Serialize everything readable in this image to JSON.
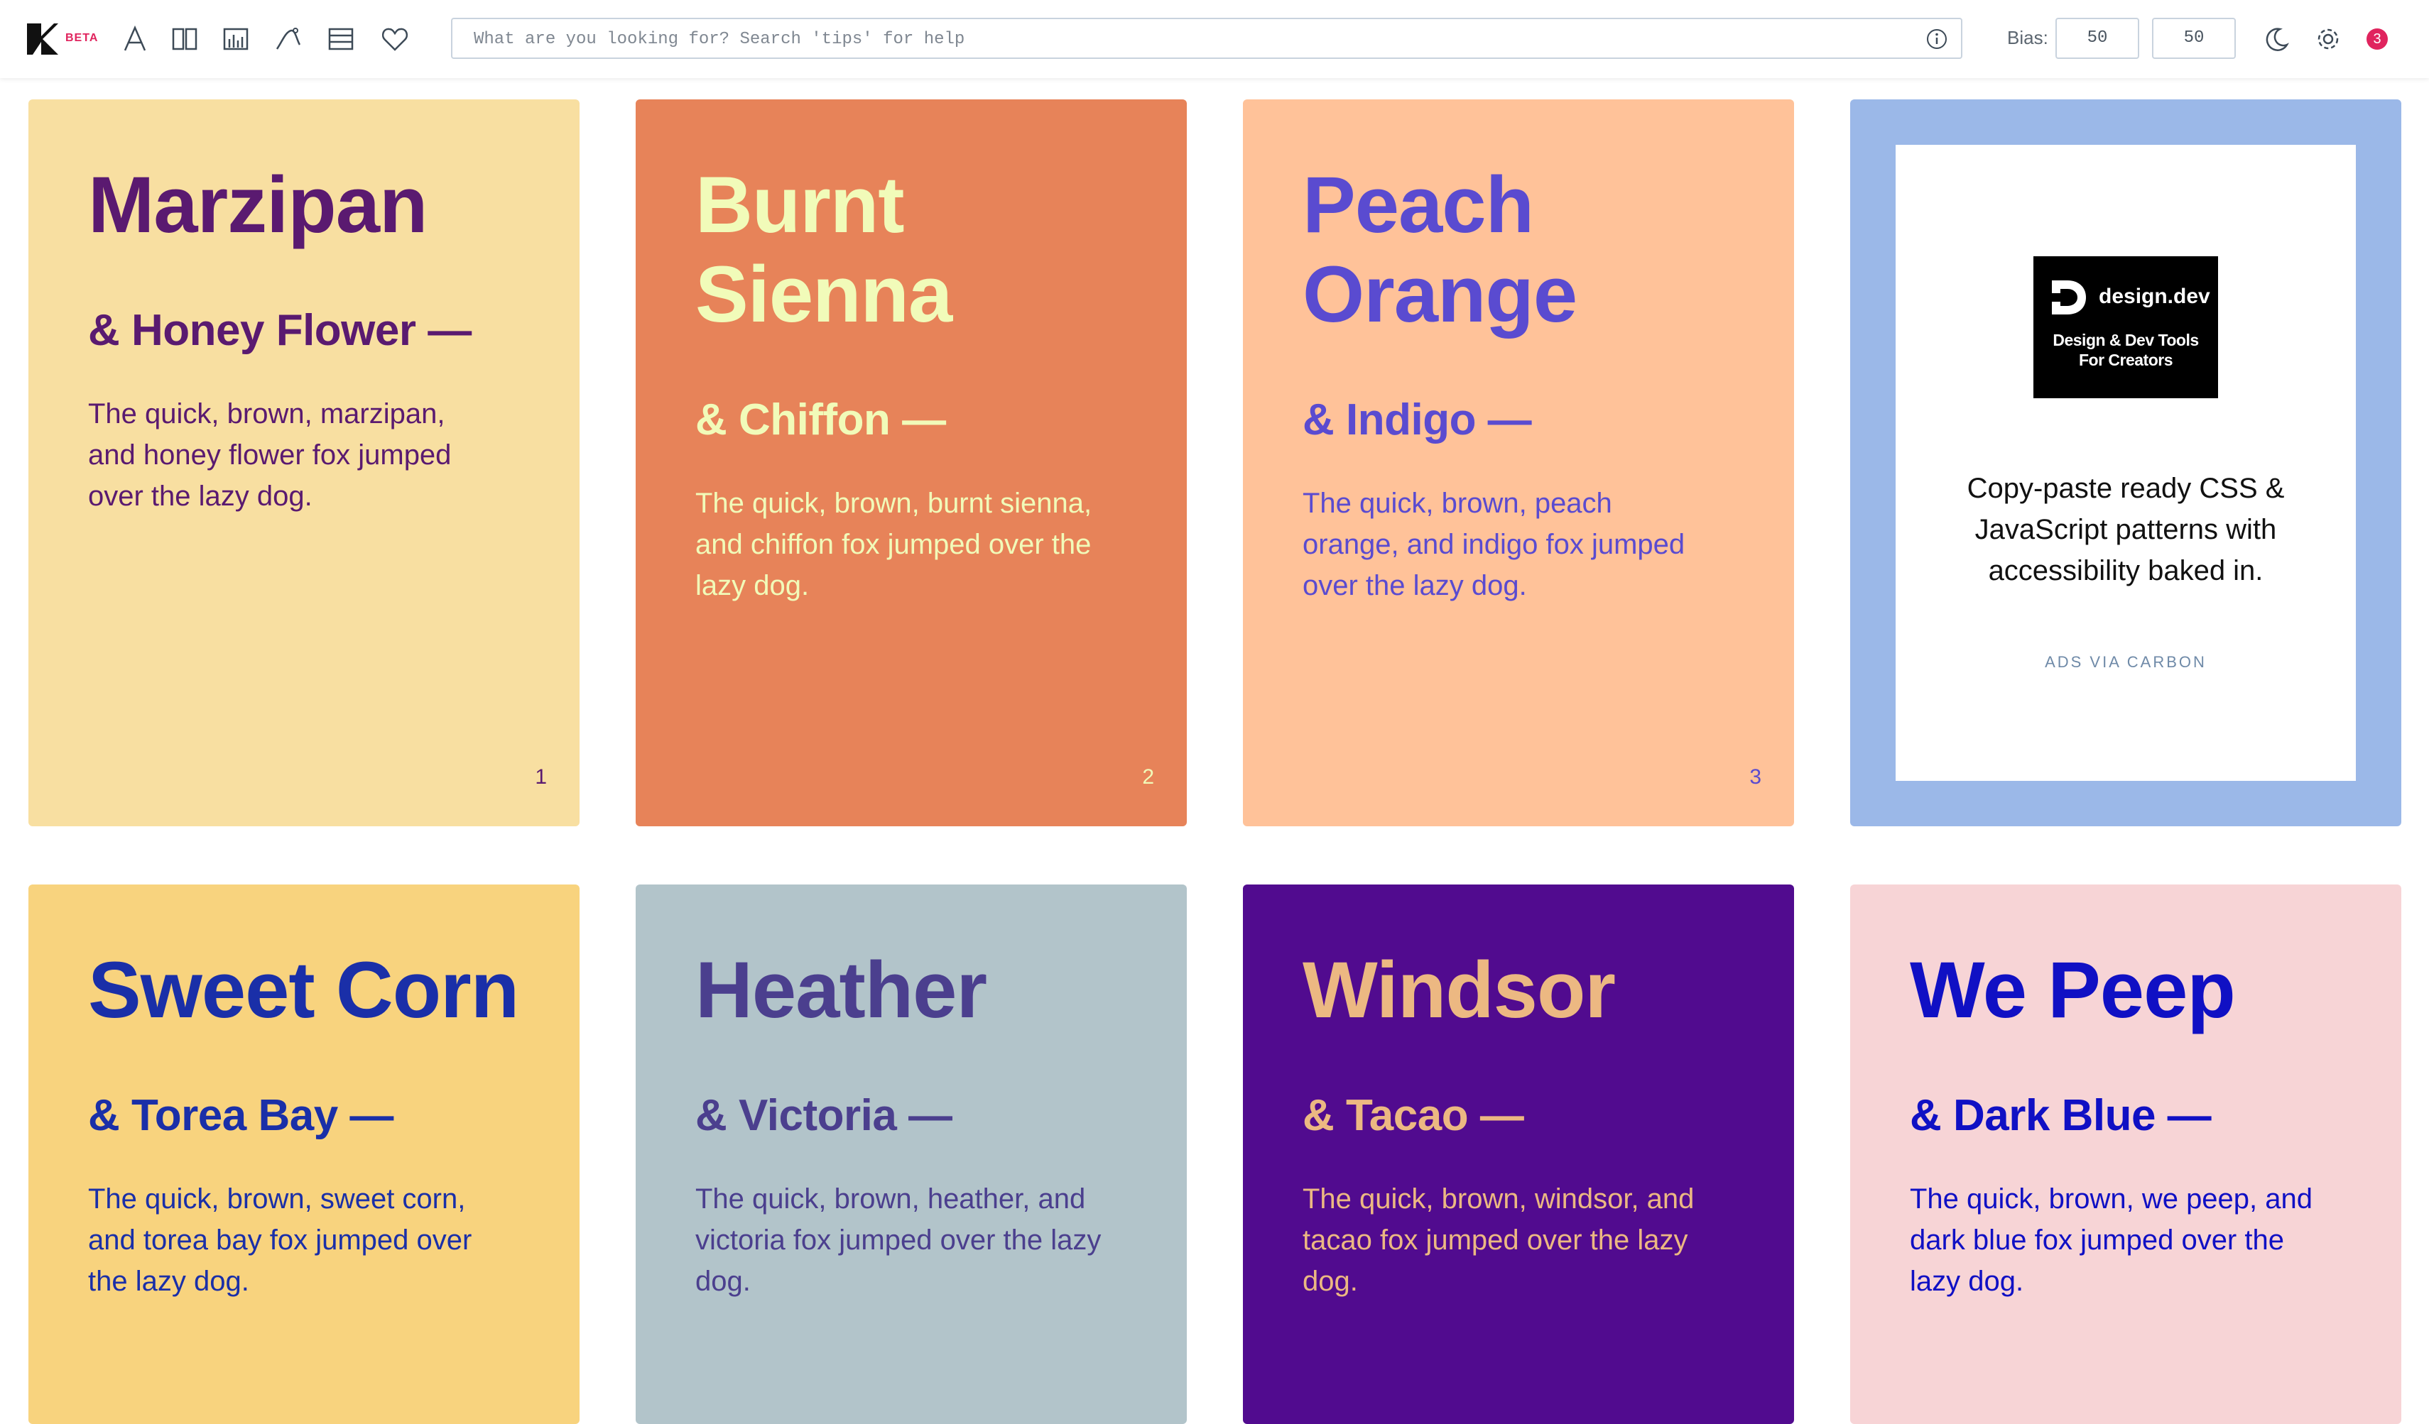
{
  "app": {
    "beta_label": "BETA",
    "icons": [
      "logo-icon",
      "font-icon",
      "columns-icon",
      "chart-icon",
      "curve-icon",
      "rows-icon",
      "heart-icon",
      "info-icon",
      "moon-icon",
      "gear-icon"
    ]
  },
  "search": {
    "placeholder": "What are you looking for? Search 'tips' for help",
    "value": ""
  },
  "bias": {
    "label": "Bias:",
    "value1": "50",
    "value2": "50"
  },
  "notifications": {
    "count": "3"
  },
  "cards": [
    {
      "title_lines": [
        "Marzipan"
      ],
      "subtitle": "& Honey Flower —",
      "body_lines": [
        "The quick, brown, marzipan,",
        "and honey flower fox jumped",
        "over the lazy dog."
      ],
      "number": "1",
      "bg": "#f8dfa1",
      "fg": "#5a1a70"
    },
    {
      "title_lines": [
        "Burnt",
        "Sienna"
      ],
      "subtitle": "& Chiffon —",
      "body_lines": [
        "The quick, brown, burnt sienna,",
        "and chiffon fox jumped over the",
        "lazy dog."
      ],
      "number": "2",
      "bg": "#e78359",
      "fg": "#f1fbb9"
    },
    {
      "title_lines": [
        "Peach",
        "Orange"
      ],
      "subtitle": "& Indigo —",
      "body_lines": [
        "The quick, brown, peach",
        "orange, and indigo fox jumped",
        "over the lazy dog."
      ],
      "number": "3",
      "bg": "#ffc299",
      "fg": "#5a4bd0"
    },
    {
      "title_lines": [
        "Sweet Corn"
      ],
      "subtitle": "& Torea Bay —",
      "body_lines": [
        "The quick, brown, sweet corn,",
        "and torea bay fox jumped over",
        "the lazy dog."
      ],
      "number": "",
      "bg": "#f8d37e",
      "fg": "#1a2fa8"
    },
    {
      "title_lines": [
        "Heather"
      ],
      "subtitle": "& Victoria —",
      "body_lines": [
        "The quick, brown, heather, and",
        "victoria fox jumped over the lazy",
        "dog."
      ],
      "number": "",
      "bg": "#b2c4ca",
      "fg": "#4b3f8e"
    },
    {
      "title_lines": [
        "Windsor"
      ],
      "subtitle": "& Tacao —",
      "body_lines": [
        "The quick, brown, windsor, and",
        "tacao fox jumped over the lazy",
        "dog."
      ],
      "number": "",
      "bg": "#510b8f",
      "fg": "#ecb882"
    },
    {
      "title_lines": [
        "We Peep"
      ],
      "subtitle": "& Dark Blue —",
      "body_lines": [
        "The quick, brown, we peep, and",
        "dark blue fox jumped over the",
        "lazy dog."
      ],
      "number": "",
      "bg": "#f7d4d6",
      "fg": "#1010c4"
    }
  ],
  "ad": {
    "brand": "design.dev",
    "tagline_lines": [
      "Design & Dev Tools",
      "For Creators"
    ],
    "text_lines": [
      "Copy-paste ready CSS &",
      "JavaScript patterns with",
      "accessibility baked in."
    ],
    "via": "ADS VIA CARBON",
    "frame_color": "#9bb8e8"
  }
}
